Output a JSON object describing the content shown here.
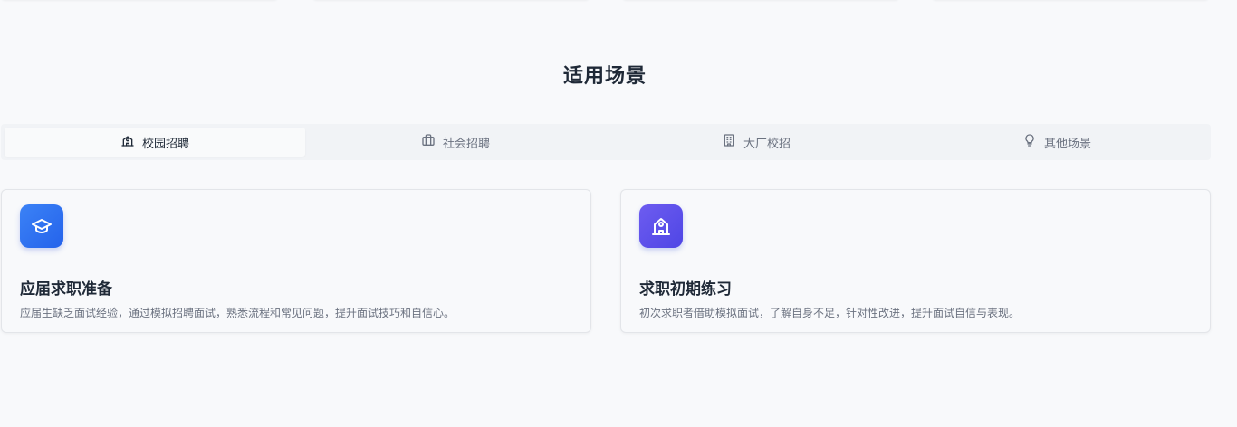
{
  "section": {
    "title": "适用场景"
  },
  "tabs": [
    {
      "label": "校园招聘",
      "icon": "school-icon",
      "active": true
    },
    {
      "label": "社会招聘",
      "icon": "briefcase-icon",
      "active": false
    },
    {
      "label": "大厂校招",
      "icon": "building-icon",
      "active": false
    },
    {
      "label": "其他场景",
      "icon": "lightbulb-icon",
      "active": false
    }
  ],
  "cards": [
    {
      "title": "应届求职准备",
      "description": "应届生缺乏面试经验，通过模拟招聘面试，熟悉流程和常见问题，提升面试技巧和自信心。",
      "icon": "graduation-cap-icon",
      "color": "#3b82f6"
    },
    {
      "title": "求职初期练习",
      "description": "初次求职者借助模拟面试，了解自身不足，针对性改进，提升面试自信与表现。",
      "icon": "school-icon",
      "color": "#5b4ee8"
    }
  ]
}
